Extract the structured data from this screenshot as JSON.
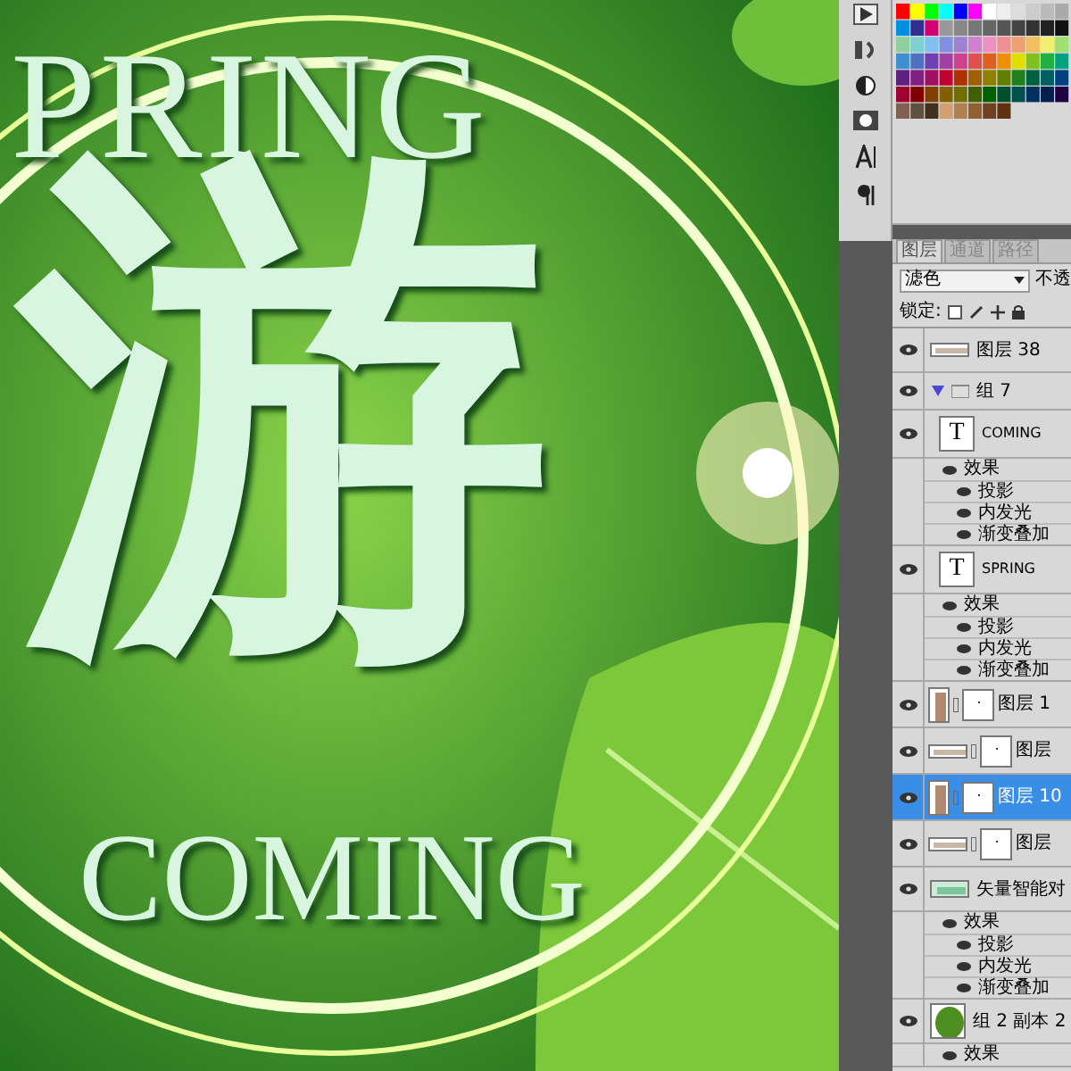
{
  "canvas": {
    "texts": [
      {
        "kind": "top",
        "text": "PRING"
      },
      {
        "kind": "main",
        "text": "游"
      },
      {
        "kind": "bottom",
        "text": "COMING"
      }
    ]
  },
  "layers_panel": {
    "tabs": [
      {
        "label": "图层",
        "selected": true
      },
      {
        "label": "通道",
        "selected": false
      },
      {
        "label": "路径",
        "selected": false
      }
    ],
    "blend_mode": "滤色",
    "opacity_label": "不透",
    "lock_label": "锁定:",
    "layers": [
      {
        "kind": "layer",
        "thumbnail": {
          "kind": "strip"
        },
        "name": "图层 38",
        "visible": true,
        "selected": false
      },
      {
        "kind": "group",
        "name": "组 7",
        "visible": true,
        "expanded": true,
        "selected": false
      },
      {
        "kind": "text",
        "glyph": "T",
        "name": "COMING",
        "visible": true,
        "selected": false,
        "effects_label": "效果",
        "effects": [
          "投影",
          "内发光",
          "渐变叠加"
        ]
      },
      {
        "kind": "text",
        "glyph": "T",
        "name": "SPRING",
        "visible": true,
        "selected": false,
        "effects_label": "效果",
        "effects": [
          "投影",
          "内发光",
          "渐变叠加"
        ]
      },
      {
        "kind": "masked",
        "thumbnail": {
          "kind": "tall"
        },
        "name": "图层 1",
        "visible": true,
        "selected": false
      },
      {
        "kind": "masked",
        "thumbnail": {
          "kind": "strip"
        },
        "name": "图层",
        "visible": true,
        "selected": false
      },
      {
        "kind": "masked",
        "thumbnail": {
          "kind": "tall"
        },
        "name": "图层 10",
        "visible": true,
        "selected": true
      },
      {
        "kind": "masked",
        "thumbnail": {
          "kind": "strip"
        },
        "name": "图层",
        "visible": true,
        "selected": false
      },
      {
        "kind": "layer",
        "thumbnail": {
          "kind": "smart"
        },
        "name": "矢量智能对",
        "visible": true,
        "selected": false,
        "effects_label": "效果",
        "effects": [
          "投影",
          "内发光",
          "渐变叠加"
        ]
      },
      {
        "kind": "layer",
        "thumbnail": {
          "kind": "leaf"
        },
        "name": "组 2 副本 2",
        "visible": true,
        "selected": false,
        "effects_label": "效果"
      }
    ]
  }
}
